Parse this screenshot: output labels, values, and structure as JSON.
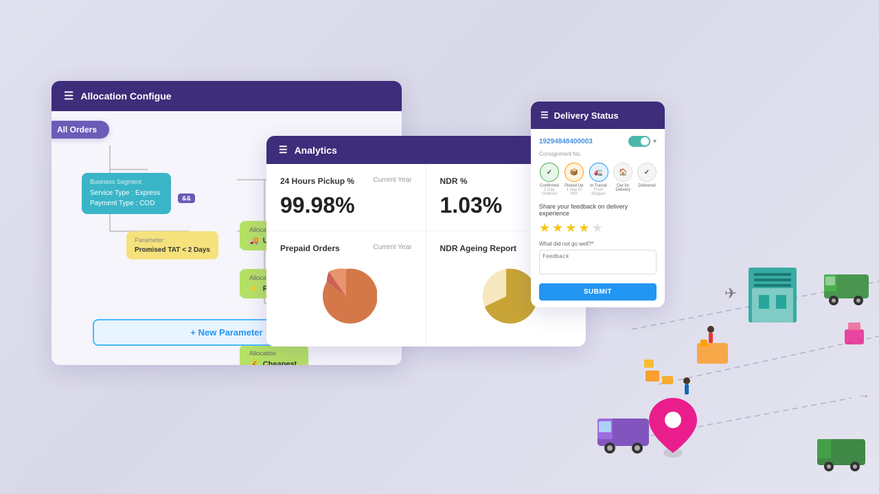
{
  "background": "#e8e8f0",
  "alloc_panel": {
    "title": "Allocation Configue",
    "all_orders_label": "All Orders",
    "biz_segment": {
      "label": "Business Segment",
      "line1": "Service Type : Express",
      "line2": "Payment Type : COD",
      "and_badge": "&&"
    },
    "parameter": {
      "label": "Parameter",
      "content": "Promised TAT  <  2 Days"
    },
    "allocations": [
      {
        "label": "Allocation",
        "icon": "🚚",
        "name": "UPS"
      },
      {
        "label": "Allocation",
        "icon": "⚡",
        "name": "Fastest"
      },
      {
        "label": "Allocation",
        "icon": "💰",
        "name": "Cheapest"
      }
    ],
    "new_param_label": "+ New Parameter"
  },
  "analytics_panel": {
    "title": "Analytics",
    "cards": [
      {
        "title": "24 Hours Pickup %",
        "subtitle": "Current Year",
        "value": "99.98%",
        "type": "number"
      },
      {
        "title": "NDR %",
        "subtitle": "Current Year",
        "value": "1.03%",
        "type": "number"
      },
      {
        "title": "Prepaid Orders",
        "subtitle": "Current Year",
        "value": "",
        "type": "pie1"
      },
      {
        "title": "NDR Ageing Report",
        "subtitle": "",
        "value": "",
        "type": "pie2"
      }
    ]
  },
  "delivery_panel": {
    "title": "Delivery Status",
    "tracking_id": "19294848400003",
    "consigned": "Consignment No.",
    "steps": [
      {
        "label": "Confirmed",
        "sublabel": "1 Day Ordered",
        "state": "active",
        "icon": "✓"
      },
      {
        "label": "Picked Up",
        "sublabel": "1 Day In WH",
        "state": "active",
        "icon": "📦"
      },
      {
        "label": "In Transit",
        "sublabel": "From Shipper",
        "state": "current",
        "icon": "🚛"
      },
      {
        "label": "Out for Delivery",
        "sublabel": "",
        "state": "inactive",
        "icon": "🏠"
      },
      {
        "label": "Delivered",
        "sublabel": "",
        "state": "inactive",
        "icon": "✓"
      }
    ],
    "feedback_title": "Share your feedback on delivery experience",
    "stars": 4,
    "question": "What did not go well?*",
    "textarea_placeholder": "Feedback",
    "submit_label": "SUBMIT"
  }
}
